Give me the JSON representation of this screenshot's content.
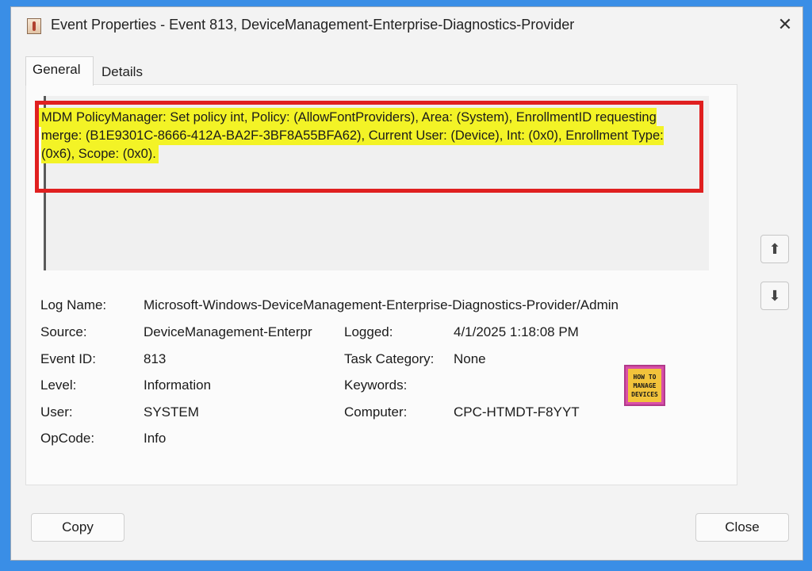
{
  "window": {
    "title": "Event Properties - Event 813, DeviceManagement-Enterprise-Diagnostics-Provider"
  },
  "tabs": [
    {
      "label": "General",
      "active": true
    },
    {
      "label": "Details",
      "active": false
    }
  ],
  "description": {
    "text": "MDM PolicyManager: Set policy int, Policy: (AllowFontProviders), Area: (System), EnrollmentID requesting merge: (B1E9301C-8666-412A-BA2F-3BF8A55BFA62), Current User: (Device), Int: (0x0), Enrollment Type: (0x6), Scope: (0x0).",
    "highlight_color": "#f3f326",
    "box_color": "#e02020"
  },
  "fields": {
    "log_name": {
      "label": "Log Name:",
      "value": "Microsoft-Windows-DeviceManagement-Enterprise-Diagnostics-Provider/Admin"
    },
    "source": {
      "label": "Source:",
      "value": "DeviceManagement-Enterpr"
    },
    "logged": {
      "label": "Logged:",
      "value": "4/1/2025 1:18:08 PM"
    },
    "event_id": {
      "label": "Event ID:",
      "value": "813"
    },
    "task_category": {
      "label": "Task Category:",
      "value": "None"
    },
    "level": {
      "label": "Level:",
      "value": "Information"
    },
    "keywords": {
      "label": "Keywords:",
      "value": ""
    },
    "user": {
      "label": "User:",
      "value": "SYSTEM"
    },
    "computer": {
      "label": "Computer:",
      "value": "CPC-HTMDT-F8YYT"
    },
    "opcode": {
      "label": "OpCode:",
      "value": "Info"
    }
  },
  "logo": {
    "line1": "HOW TO",
    "line2": "MANAGE",
    "line3": "DEVICES"
  },
  "buttons": {
    "copy": "Copy",
    "close": "Close"
  },
  "icons": {
    "close": "close-icon",
    "up": "arrow-up-icon",
    "down": "arrow-down-icon"
  },
  "colors": {
    "background": "#3a8ee6",
    "window": "#f3f3f3"
  }
}
